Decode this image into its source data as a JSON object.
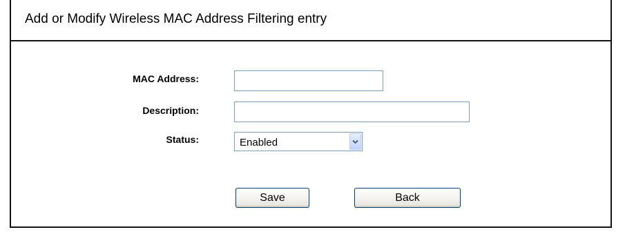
{
  "page": {
    "title": "Add or Modify Wireless MAC Address Filtering entry"
  },
  "form": {
    "mac_address_label": "MAC Address:",
    "mac_address_value": "",
    "description_label": "Description:",
    "description_value": "",
    "status_label": "Status:",
    "status_selected": "Enabled"
  },
  "buttons": {
    "save_label": "Save",
    "back_label": "Back"
  },
  "icons": {
    "select_arrow": "chevron-down-icon"
  },
  "colors": {
    "border": "#111111",
    "input_border": "#7f9db9",
    "button_border": "#003c74",
    "arrow_color": "#4d6185"
  }
}
